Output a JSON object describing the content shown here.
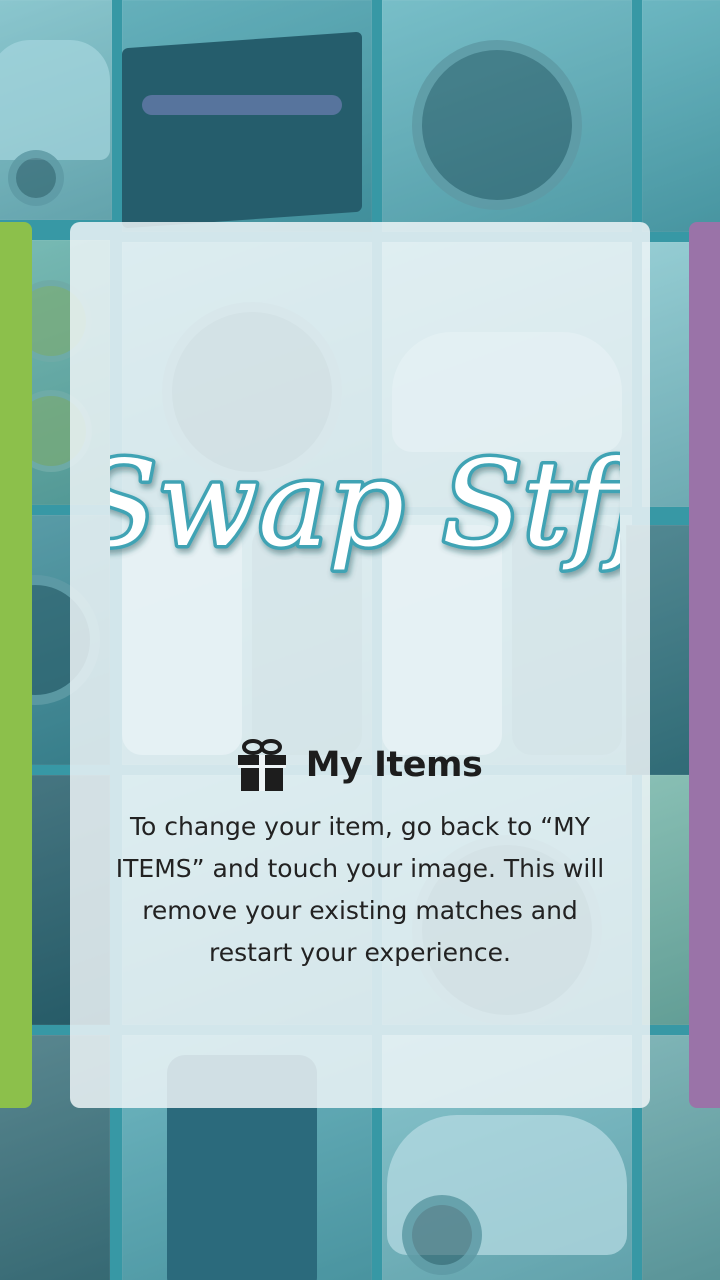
{
  "app": {
    "logo_text": "Swap Stff"
  },
  "tip": {
    "icon": "gift-icon",
    "title": "My Items",
    "body": "To change your item, go back to “MY ITEMS” and touch your image. This will remove your existing matches and restart your experience."
  },
  "colors": {
    "left_card": "#8cc04b",
    "right_card": "#9a73a8",
    "logo_fill": "#ffffff",
    "logo_outline": "#3fa3b4",
    "background_tint": "#4fb3bf"
  },
  "background_tiles": [
    "car-photo",
    "tablet-photo",
    "watch-photo",
    "jar-photo",
    "watch-photo",
    "car-photo",
    "phone-photo",
    "phone-photo",
    "phone-photo",
    "phone-photo",
    "watch-photo",
    "car-photo"
  ]
}
